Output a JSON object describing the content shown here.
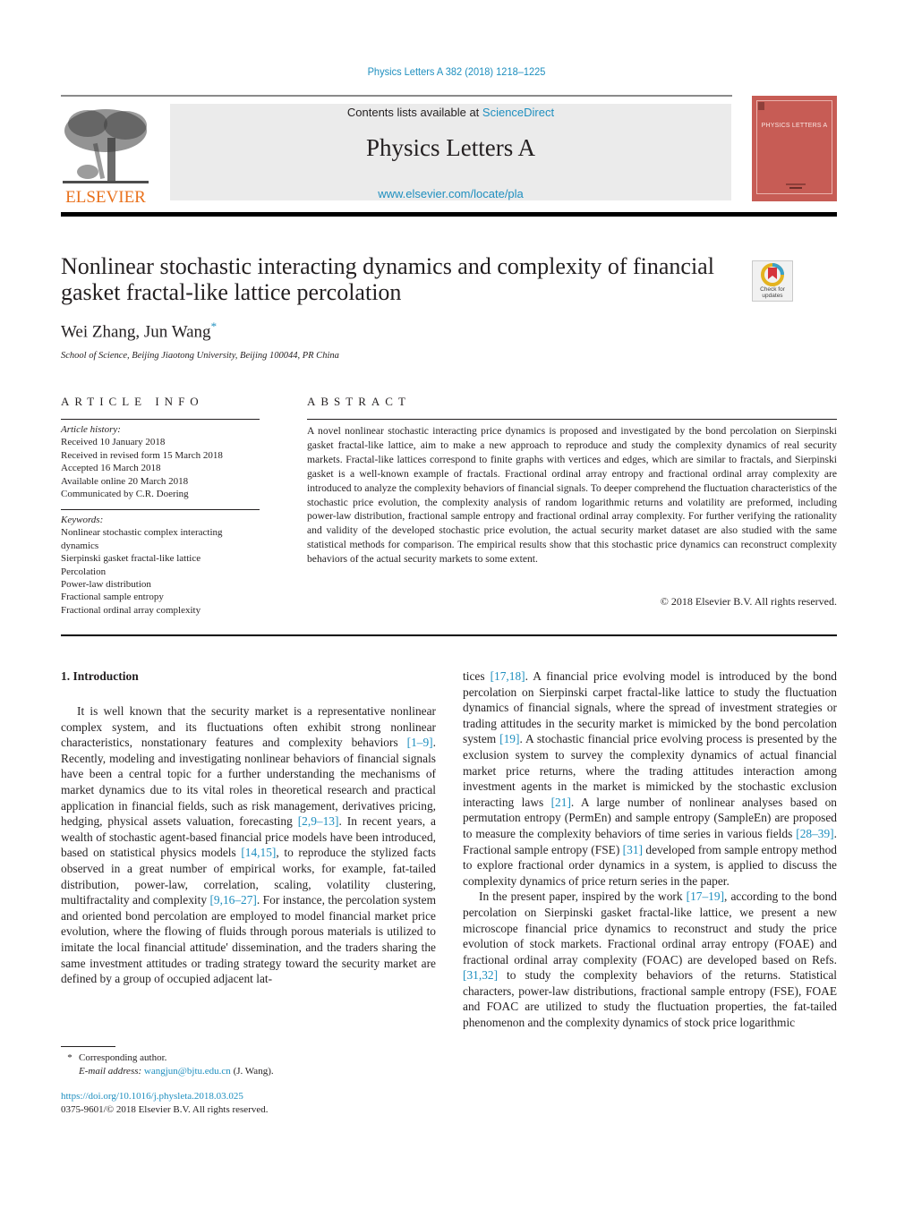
{
  "header": {
    "journal_reference": "Physics Letters A 382 (2018) 1218–1225",
    "contents_prefix": "Contents lists available at ",
    "contents_link": "ScienceDirect",
    "journal_name": "Physics Letters A",
    "journal_url": "www.elsevier.com/locate/pla",
    "publisher_logo_text": "ELSEVIER",
    "cover_title": "PHYSICS LETTERS A",
    "check_updates_label_1": "Check for",
    "check_updates_label_2": "updates"
  },
  "colors": {
    "link": "#1f8fbf",
    "elsevier_orange": "#e9711c",
    "cover_red": "#c75c55",
    "masthead_gray": "#ebebeb"
  },
  "article": {
    "title_line_1": "Nonlinear stochastic interacting dynamics and complexity of financial",
    "title_line_2": "gasket fractal-like lattice percolation",
    "authors": "Wei Zhang, Jun Wang",
    "corresponding_mark": "*",
    "affiliation": "School of Science, Beijing Jiaotong University, Beijing 100044, PR China"
  },
  "article_info": {
    "heading": "ARTICLE INFO",
    "history_label": "Article history:",
    "history": [
      "Received 10 January 2018",
      "Received in revised form 15 March 2018",
      "Accepted 16 March 2018",
      "Available online 20 March 2018",
      "Communicated by C.R. Doering"
    ],
    "keywords_label": "Keywords:",
    "keywords": [
      "Nonlinear stochastic complex interacting",
      "dynamics",
      "Sierpinski gasket fractal-like lattice",
      "Percolation",
      "Power-law distribution",
      "Fractional sample entropy",
      "Fractional ordinal array complexity"
    ]
  },
  "abstract": {
    "heading": "ABSTRACT",
    "text": "A novel nonlinear stochastic interacting price dynamics is proposed and investigated by the bond percolation on Sierpinski gasket fractal-like lattice, aim to make a new approach to reproduce and study the complexity dynamics of real security markets. Fractal-like lattices correspond to finite graphs with vertices and edges, which are similar to fractals, and Sierpinski gasket is a well-known example of fractals. Fractional ordinal array entropy and fractional ordinal array complexity are introduced to analyze the complexity behaviors of financial signals. To deeper comprehend the fluctuation characteristics of the stochastic price evolution, the complexity analysis of random logarithmic returns and volatility are preformed, including power-law distribution, fractional sample entropy and fractional ordinal array complexity. For further verifying the rationality and validity of the developed stochastic price evolution, the actual security market dataset are also studied with the same statistical methods for comparison. The empirical results show that this stochastic price dynamics can reconstruct complexity behaviors of the actual security markets to some extent.",
    "copyright": "© 2018 Elsevier B.V. All rights reserved."
  },
  "body": {
    "section_heading": "1.  Introduction",
    "left": {
      "s1": "It is well known that the security market is a representative nonlinear complex system, and its fluctuations often exhibit strong nonlinear characteristics, nonstationary features and complexity behaviors ",
      "c1": "[1–9]",
      "s2": ". Recently, modeling and investigating nonlinear behaviors of financial signals have been a central topic for a further understanding the mechanisms of market dynamics due to its vital roles in theoretical research and practical application in financial fields, such as risk management, derivatives pricing, hedging, physical assets valuation, forecasting ",
      "c2": "[2,9–13]",
      "s3": ". In recent years, a wealth of stochastic agent-based financial price models have been introduced, based on statistical physics models ",
      "c3": "[14,15]",
      "s4": ", to reproduce the stylized facts observed in a great number of empirical works, for example, fat-tailed distribution, power-law, correlation, scaling, volatility clustering, multifractality and complexity ",
      "c4": "[9,16–27]",
      "s5": ". For instance, the percolation system and oriented bond percolation are employed to model financial market price evolution, where the flowing of fluids through porous materials is utilized to imitate the local financial attitude' dissemination, and the traders sharing the same investment attitudes or trading strategy toward the security market are defined by a group of occupied adjacent lat-"
    },
    "right": {
      "s1": "tices ",
      "c1": "[17,18]",
      "s2": ". A financial price evolving model is introduced by the bond percolation on Sierpinski carpet fractal-like lattice to study the fluctuation dynamics of financial signals, where the spread of investment strategies or trading attitudes in the security market is mimicked by the bond percolation system ",
      "c2": "[19]",
      "s3": ". A stochastic financial price evolving process is presented by the exclusion system to survey the complexity dynamics of actual financial market price returns, where the trading attitudes interaction among investment agents in the market is mimicked by the stochastic exclusion interacting laws ",
      "c3": "[21]",
      "s4": ". A large number of nonlinear analyses based on permutation entropy (PermEn) and sample entropy (SampleEn) are proposed to measure the complexity behaviors of time series in various fields ",
      "c4": "[28–39]",
      "s5": ". Fractional sample entropy (FSE) ",
      "c5": "[31]",
      "s6": " developed from sample entropy method to explore fractional order dynamics in a system, is applied to discuss the complexity dynamics of price return series in the paper.",
      "p2_s1": "In the present paper, inspired by the work ",
      "p2_c1": "[17–19]",
      "p2_s2": ", according to the bond percolation on Sierpinski gasket fractal-like lattice, we present a new microscope financial price dynamics to reconstruct and study the price evolution of stock markets. Fractional ordinal array entropy (FOAE) and fractional ordinal array complexity (FOAC) are developed based on Refs. ",
      "p2_c2": "[31,32]",
      "p2_s3": " to study the complexity behaviors of the returns. Statistical characters, power-law distributions, fractional sample entropy (FSE), FOAE and FOAC are utilized to study the fluctuation properties, the fat-tailed phenomenon and the complexity dynamics of stock price logarithmic"
    }
  },
  "footnote": {
    "mark": "*",
    "corresponding": "Corresponding author.",
    "email_label": "E-mail address:",
    "email": "wangjun@bjtu.edu.cn",
    "email_suffix": " (J. Wang)."
  },
  "doi": {
    "url": "https://doi.org/10.1016/j.physleta.2018.03.025",
    "issn_copyright": "0375-9601/© 2018 Elsevier B.V. All rights reserved."
  }
}
